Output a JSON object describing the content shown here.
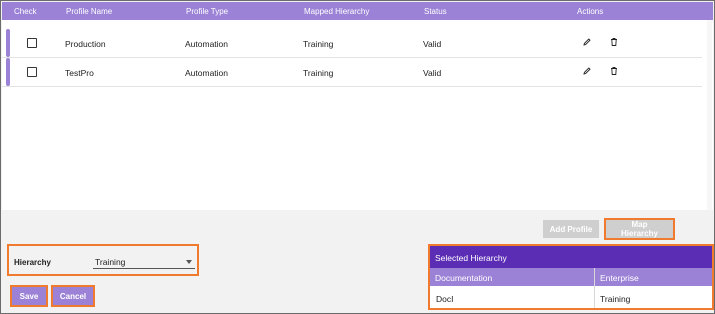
{
  "table": {
    "headers": [
      "Check",
      "Profile Name",
      "Profile Type",
      "Mapped Hierarchy",
      "Status",
      "Actions"
    ],
    "rows": [
      {
        "name": "Production",
        "type": "Automation",
        "hierarchy": "Training",
        "status": "Valid"
      },
      {
        "name": "TestPro",
        "type": "Automation",
        "hierarchy": "Training",
        "status": "Valid"
      }
    ]
  },
  "buttons": {
    "add_profile": "Add Profile",
    "map_hierarchy": "Map Hierarchy",
    "save": "Save",
    "cancel": "Cancel"
  },
  "hierarchy": {
    "label": "Hierarchy",
    "value": "Training"
  },
  "selected_hierarchy": {
    "title": "Selected Hierarchy",
    "columns": [
      "Documentation",
      "Enterprise"
    ],
    "row": [
      "DocI",
      "Training"
    ]
  },
  "colors": {
    "accent": "#9b82d6",
    "panel_title": "#5b2db5",
    "highlight": "#f07a2d"
  },
  "icons": [
    "edit-icon",
    "delete-icon",
    "dropdown-caret-icon",
    "checkbox-icon"
  ]
}
